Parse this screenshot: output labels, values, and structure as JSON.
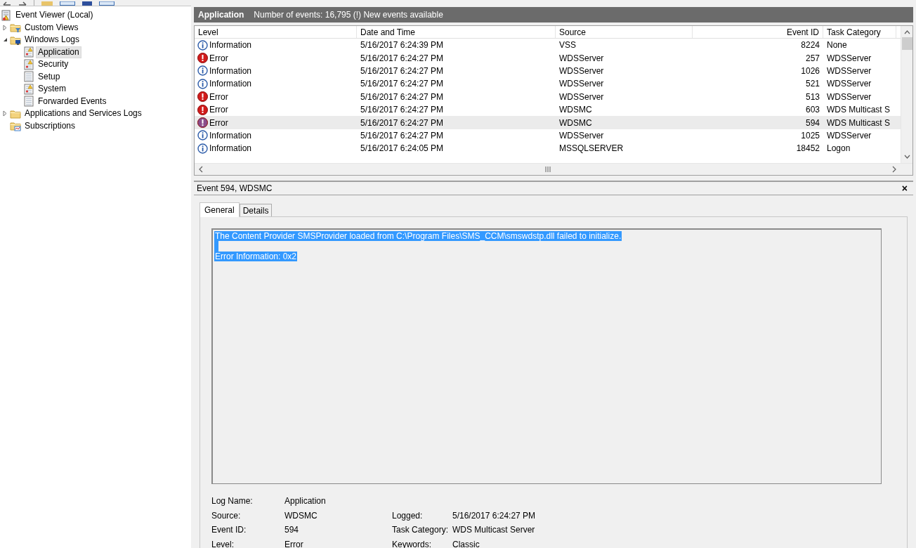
{
  "tree": [
    {
      "label": "Event Viewer (Local)",
      "kind": "root",
      "selected": false,
      "children": [
        {
          "label": "Custom Views",
          "kind": "filter-folder",
          "expanded": false,
          "selected": false
        },
        {
          "label": "Windows Logs",
          "kind": "logs-folder",
          "expanded": true,
          "selected": false,
          "children": [
            {
              "label": "Application",
              "kind": "alert-log",
              "selected": true
            },
            {
              "label": "Security",
              "kind": "alert-log",
              "selected": false
            },
            {
              "label": "Setup",
              "kind": "log",
              "selected": false
            },
            {
              "label": "System",
              "kind": "alert-log",
              "selected": false
            },
            {
              "label": "Forwarded Events",
              "kind": "log",
              "selected": false
            }
          ]
        },
        {
          "label": "Applications and Services Logs",
          "kind": "folder",
          "expanded": false,
          "selected": false
        },
        {
          "label": "Subscriptions",
          "kind": "subscriptions-folder",
          "selected": false
        }
      ]
    }
  ],
  "list_header": {
    "title": "Application",
    "summary": "Number of events: 16,795 (!) New events available"
  },
  "table": {
    "columns": [
      "Level",
      "Date and Time",
      "Source",
      "Event ID",
      "Task Category"
    ],
    "rows": [
      {
        "kind": "information",
        "level": "Information",
        "date": "5/16/2017 6:24:39 PM",
        "source": "VSS",
        "event_id": "8224",
        "task_category": "None",
        "selected": false
      },
      {
        "kind": "error",
        "level": "Error",
        "date": "5/16/2017 6:24:27 PM",
        "source": "WDSServer",
        "event_id": "257",
        "task_category": "WDSServer",
        "selected": false
      },
      {
        "kind": "information",
        "level": "Information",
        "date": "5/16/2017 6:24:27 PM",
        "source": "WDSServer",
        "event_id": "1026",
        "task_category": "WDSServer",
        "selected": false
      },
      {
        "kind": "information",
        "level": "Information",
        "date": "5/16/2017 6:24:27 PM",
        "source": "WDSServer",
        "event_id": "521",
        "task_category": "WDSServer",
        "selected": false
      },
      {
        "kind": "error",
        "level": "Error",
        "date": "5/16/2017 6:24:27 PM",
        "source": "WDSServer",
        "event_id": "513",
        "task_category": "WDSServer",
        "selected": false
      },
      {
        "kind": "error",
        "level": "Error",
        "date": "5/16/2017 6:24:27 PM",
        "source": "WDSMC",
        "event_id": "603",
        "task_category": "WDS Multicast S",
        "selected": false
      },
      {
        "kind": "error",
        "level": "Error",
        "date": "5/16/2017 6:24:27 PM",
        "source": "WDSMC",
        "event_id": "594",
        "task_category": "WDS Multicast S",
        "selected": true
      },
      {
        "kind": "information",
        "level": "Information",
        "date": "5/16/2017 6:24:27 PM",
        "source": "WDSServer",
        "event_id": "1025",
        "task_category": "WDSServer",
        "selected": false
      },
      {
        "kind": "information",
        "level": "Information",
        "date": "5/16/2017 6:24:05 PM",
        "source": "MSSQLSERVER",
        "event_id": "18452",
        "task_category": "Logon",
        "selected": false
      }
    ]
  },
  "details": {
    "title": "Event 594, WDSMC",
    "close": "×",
    "tabs": [
      {
        "label": "General",
        "selected": true
      },
      {
        "label": "Details",
        "selected": false
      }
    ],
    "message": [
      "The Content Provider SMSProvider loaded from C:\\Program Files\\SMS_CCM\\smswdstp.dll failed to initialize.",
      "Error Information: 0x2"
    ],
    "message_selected": true,
    "fields": [
      {
        "left": {
          "label": "Log Name:",
          "value": "Application"
        }
      },
      {
        "left": {
          "label": "Source:",
          "value": "WDSMC"
        },
        "right": {
          "label": "Logged:",
          "value": "5/16/2017 6:24:27 PM"
        }
      },
      {
        "left": {
          "label": "Event ID:",
          "value": "594"
        },
        "right": {
          "label": "Task Category:",
          "value": "WDS Multicast Server"
        }
      },
      {
        "left": {
          "label": "Level:",
          "value": "Error"
        },
        "right": {
          "label": "Keywords:",
          "value": "Classic"
        }
      }
    ]
  }
}
